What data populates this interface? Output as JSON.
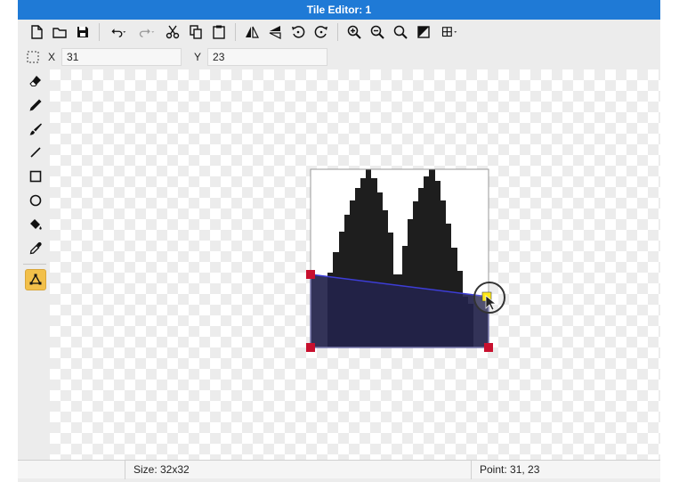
{
  "window": {
    "title": "Tile Editor: 1"
  },
  "toolbar": {
    "items": [
      {
        "name": "new-file-icon"
      },
      {
        "name": "open-folder-icon"
      },
      {
        "name": "save-icon"
      },
      {
        "name": "undo-icon"
      },
      {
        "name": "redo-icon"
      },
      {
        "name": "cut-icon"
      },
      {
        "name": "copy-icon"
      },
      {
        "name": "paste-icon"
      },
      {
        "name": "flip-horizontal-icon"
      },
      {
        "name": "flip-vertical-icon"
      },
      {
        "name": "rotate-left-icon"
      },
      {
        "name": "rotate-right-icon"
      },
      {
        "name": "zoom-in-icon"
      },
      {
        "name": "zoom-out-icon"
      },
      {
        "name": "zoom-fit-icon"
      },
      {
        "name": "transparency-icon"
      },
      {
        "name": "grid-icon"
      }
    ]
  },
  "coords": {
    "x_label": "X",
    "x_value": "31",
    "y_label": "Y",
    "y_value": "23"
  },
  "tools": {
    "items": [
      {
        "name": "eraser-icon",
        "active": false
      },
      {
        "name": "pencil-icon",
        "active": false
      },
      {
        "name": "brush-icon",
        "active": false
      },
      {
        "name": "line-icon",
        "active": false
      },
      {
        "name": "rectangle-icon",
        "active": false
      },
      {
        "name": "ellipse-icon",
        "active": false
      },
      {
        "name": "fill-bucket-icon",
        "active": false
      },
      {
        "name": "eyedropper-icon",
        "active": false
      },
      {
        "name": "polygon-icon",
        "active": true
      }
    ]
  },
  "canvas": {
    "tile_size": [
      32,
      32
    ],
    "shape_color": "#1e1e1e",
    "selection_color": "#23234a",
    "handle_color": "#c8102e",
    "active_handle_color": "#ffe81a"
  },
  "status": {
    "size_text": "Size: 32x32",
    "point_text": "Point: 31, 23"
  },
  "colors": {
    "title_bar": "#1f7ad6",
    "active_tool": "#f2c04a"
  }
}
